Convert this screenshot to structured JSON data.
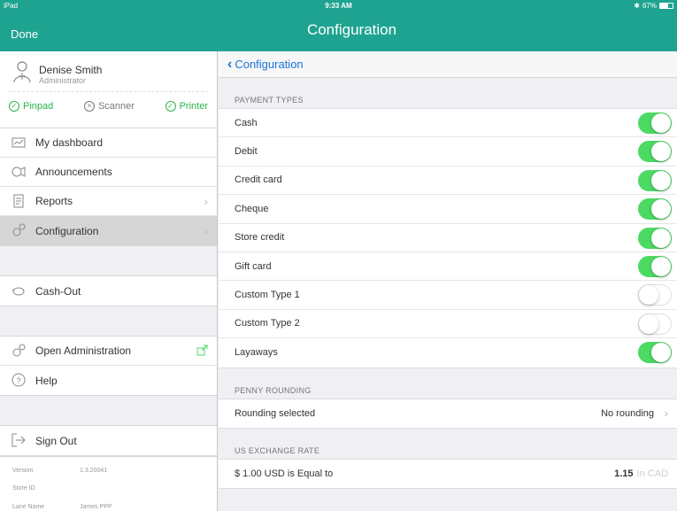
{
  "status": {
    "device": "iPad",
    "time": "9:33 AM",
    "battery": "67%",
    "battery_level": 0.67
  },
  "navbar": {
    "done_label": "Done",
    "title": "Configuration"
  },
  "user": {
    "name": "Denise Smith",
    "role": "Administrator"
  },
  "devices": [
    {
      "label": "Pinpad",
      "state": "connected"
    },
    {
      "label": "Scanner",
      "state": "disconnected"
    },
    {
      "label": "Printer",
      "state": "connected"
    }
  ],
  "menu": {
    "dashboard": "My dashboard",
    "announcements": "Announcements",
    "reports": "Reports",
    "configuration": "Configuration",
    "cashout": "Cash-Out",
    "open_admin": "Open Administration",
    "help": "Help",
    "signout": "Sign Out"
  },
  "version_info": {
    "version_label": "Version",
    "version_value": "1.3.20041",
    "store_label": "Store ID",
    "store_value": "",
    "lane_label": "Lane Name",
    "lane_value": "James PPP"
  },
  "main": {
    "back_label": "Configuration",
    "payment_types_header": "PAYMENT TYPES",
    "payment_types": [
      {
        "label": "Cash",
        "enabled": true
      },
      {
        "label": "Debit",
        "enabled": true
      },
      {
        "label": "Credit card",
        "enabled": true
      },
      {
        "label": "Cheque",
        "enabled": true
      },
      {
        "label": "Store credit",
        "enabled": true
      },
      {
        "label": "Gift card",
        "enabled": true
      },
      {
        "label": "Custom Type 1",
        "enabled": false
      },
      {
        "label": "Custom Type 2",
        "enabled": false
      },
      {
        "label": "Layaways",
        "enabled": true
      }
    ],
    "penny_header": "PENNY ROUNDING",
    "rounding_label": "Rounding selected",
    "rounding_value": "No rounding",
    "exchange_header": "US EXCHANGE RATE",
    "exchange_label": "$ 1.00 USD is Equal to",
    "exchange_value": "1.15",
    "exchange_unit": "In CAD"
  },
  "colors": {
    "brand": "#1fa391",
    "toggle_on": "#4cd964",
    "link": "#1a73d8",
    "connected": "#2db34a"
  }
}
